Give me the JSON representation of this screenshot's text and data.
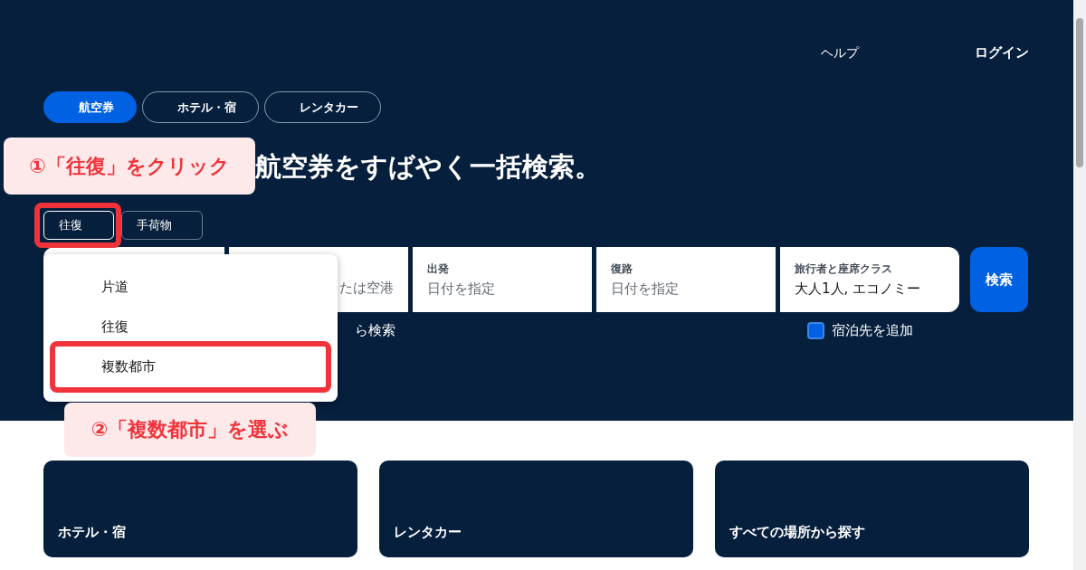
{
  "header": {
    "links": [
      "ヘルプ",
      "ログイン"
    ]
  },
  "tabs": [
    {
      "label": "航空券",
      "selected": true
    },
    {
      "label": "ホテル・宿",
      "selected": false
    },
    {
      "label": "レンタカー",
      "selected": false
    }
  ],
  "heading": "航空券をすばやく一括検索。",
  "trip_controls": [
    {
      "label": "往復",
      "expanded": true
    },
    {
      "label": "手荷物",
      "expanded": false
    }
  ],
  "fields": [
    {
      "kind": "blank"
    },
    {
      "kind": "place",
      "placeholder": "たは空港"
    },
    {
      "kind": "date",
      "label": "出発",
      "placeholder": "日付を指定"
    },
    {
      "kind": "date",
      "label": "復路",
      "placeholder": "日付を指定"
    },
    {
      "kind": "travelers",
      "label": "旅行者と座席クラス",
      "value": "大人1人, エコノミー"
    }
  ],
  "search_button": "検索",
  "nearby_link": "ら検索",
  "add_stay": {
    "label": "宿泊先を追加",
    "checked": false
  },
  "dropdown": {
    "items": [
      "片道",
      "往復",
      "複数都市"
    ]
  },
  "annotations": [
    "①「往復」をクリック",
    "②「複数都市」を選ぶ"
  ],
  "cards": [
    "ホテル・宿",
    "レンタカー",
    "すべての場所から探す"
  ]
}
